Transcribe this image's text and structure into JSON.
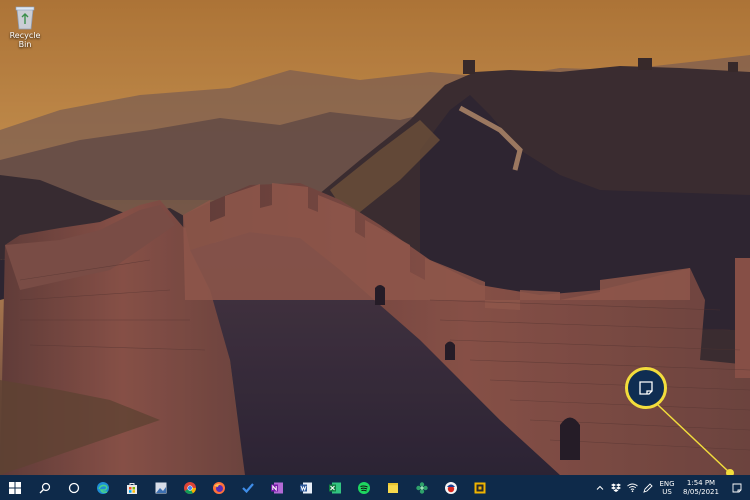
{
  "desktop": {
    "icons": [
      {
        "label": "Recycle Bin",
        "icon": "recycle-bin-icon"
      }
    ]
  },
  "taskbar": {
    "pinned": [
      {
        "name": "start-button",
        "icon": "windows-logo-icon"
      },
      {
        "name": "search-button",
        "icon": "search-icon"
      },
      {
        "name": "cortana-button",
        "icon": "cortana-circle-icon"
      },
      {
        "name": "edge-button",
        "icon": "edge-icon"
      },
      {
        "name": "store-button",
        "icon": "store-bag-icon"
      },
      {
        "name": "photos-button",
        "icon": "photos-icon"
      },
      {
        "name": "chrome-button",
        "icon": "chrome-icon"
      },
      {
        "name": "firefox-button",
        "icon": "firefox-icon"
      },
      {
        "name": "todo-button",
        "icon": "checkmark-icon"
      },
      {
        "name": "onenote-button",
        "icon": "onenote-icon"
      },
      {
        "name": "word-button",
        "icon": "word-icon"
      },
      {
        "name": "excel-button",
        "icon": "excel-icon"
      },
      {
        "name": "spotify-button",
        "icon": "spotify-icon"
      },
      {
        "name": "sticky-notes-button",
        "icon": "sticky-note-icon"
      },
      {
        "name": "app-button",
        "icon": "flower-icon"
      },
      {
        "name": "app2-button",
        "icon": "circle-app-icon"
      },
      {
        "name": "app3-button",
        "icon": "square-app-icon"
      }
    ],
    "tray": {
      "language_line1": "ENG",
      "language_line2": "US",
      "time": "1:54 PM",
      "date": "8/05/2021"
    }
  },
  "callout": {
    "target": "action-center-button",
    "icon": "notification-icon",
    "color": "#f2dd3c"
  },
  "colors": {
    "taskbar": "#0e2a4a",
    "sky_top": "#cf8a3c",
    "sky_bottom": "#f2b35a"
  }
}
